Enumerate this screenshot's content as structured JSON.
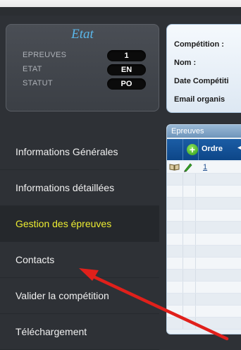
{
  "status": {
    "title": "Etat",
    "rows": [
      {
        "label": "EPREUVES",
        "value": "1"
      },
      {
        "label": "ETAT",
        "value": "EN"
      },
      {
        "label": "STATUT",
        "value": "PO"
      }
    ]
  },
  "info": {
    "competition": "Compétition :",
    "nom": "Nom :",
    "date": "Date Compétiti",
    "email": "Email organis"
  },
  "nav": {
    "items": [
      {
        "label": "Informations Générales"
      },
      {
        "label": "Informations détaillées"
      },
      {
        "label": "Gestion des épreuves"
      },
      {
        "label": "Contacts"
      },
      {
        "label": "Valider la compétition"
      },
      {
        "label": "Téléchargement"
      }
    ]
  },
  "grid": {
    "caption": "Epreuves",
    "col_ordre": "Ordre",
    "sort_icon": "sort-arrow-icon",
    "first_row_ordre": "1"
  },
  "colors": {
    "accent": "#5ab7ea",
    "active_nav": "#eded32",
    "annotation": "#e0201b"
  }
}
